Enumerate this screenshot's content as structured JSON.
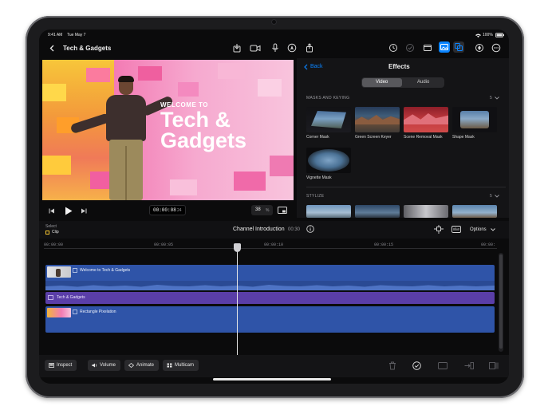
{
  "status_bar": {
    "time": "9:41 AM",
    "date": "Tue May 7",
    "battery": "100%"
  },
  "nav": {
    "title": "Tech & Gadgets"
  },
  "viewer": {
    "overlay_small": "WELCOME TO",
    "overlay_line1": "Tech &",
    "overlay_line2": "Gadgets"
  },
  "playback": {
    "timecode": "00:00:08",
    "frame": "24",
    "zoom": "38",
    "zoom_unit": "%"
  },
  "effects": {
    "back_label": "Back",
    "title": "Effects",
    "tabs": [
      "Video",
      "Audio"
    ],
    "sections": [
      {
        "title": "MASKS AND KEYING",
        "count": "5",
        "items": [
          "Corner Mask",
          "Green Screen Keyer",
          "Scene Removal Mask",
          "Shape Mask",
          "Vignette Mask"
        ]
      },
      {
        "title": "STYLIZE",
        "count": "5"
      }
    ]
  },
  "timeline": {
    "select_label": "Select",
    "select_value": "Clip",
    "project_name": "Channel Introduction",
    "duration": "00:30",
    "options_label": "Options",
    "ruler": [
      "00:00:00",
      "00:00:05",
      "00:00:10",
      "00:00:15",
      "00:00:"
    ],
    "tracks": [
      "Welcome to Tech & Gadgets",
      "Tech & Gadgets",
      "Rectangle Pixelation"
    ]
  },
  "bottom": {
    "inspect": "Inspect",
    "volume": "Volume",
    "animate": "Animate",
    "multicam": "Multicam"
  },
  "colors": {
    "accent": "#0a84ff",
    "clip_blue": "#2f54a8",
    "title_purple": "#5a3ea8"
  }
}
